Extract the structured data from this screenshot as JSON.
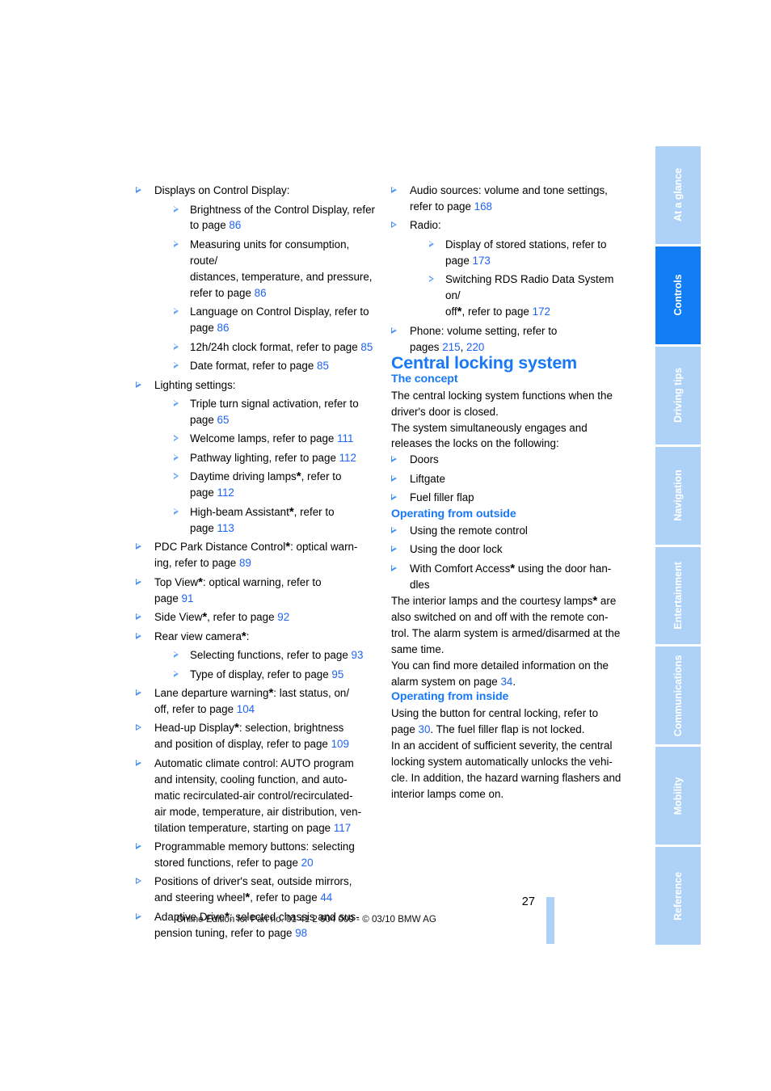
{
  "document": {
    "page_number": "27",
    "footer_text": "Online Edition for Part no. 01 41 2 604 009 - © 03/10 BMW AG"
  },
  "colors": {
    "heading_blue": "#1878f5",
    "link_blue": "#1f63f5",
    "tab_active": "#127ef5",
    "tab_inactive": "#aed2f7",
    "bullet_blue": "#4a90f0"
  },
  "chapter_tabs": [
    {
      "label": "At a glance",
      "active": false
    },
    {
      "label": "Controls",
      "active": true
    },
    {
      "label": "Driving tips",
      "active": false
    },
    {
      "label": "Navigation",
      "active": false
    },
    {
      "label": "Entertainment",
      "active": false
    },
    {
      "label": "Communications",
      "active": false
    },
    {
      "label": "Mobility",
      "active": false
    },
    {
      "label": "Reference",
      "active": false
    }
  ],
  "left_column": {
    "items": {
      "displays_heading": "Displays on Control Display:",
      "displays_sub": {
        "brightness_a": "Brightness of the Control Display, refer",
        "brightness_b": "to page ",
        "brightness_page": "86",
        "units_a": "Measuring units for consumption, route/",
        "units_b": "distances, temperature, and pressure,",
        "units_c": "refer to page ",
        "units_page": "86",
        "language_a": "Language on Control Display, refer to",
        "language_b": "page ",
        "language_page": "86",
        "clock_a": "12h/24h clock format, refer to page ",
        "clock_page": "85",
        "date_a": "Date format, refer to page ",
        "date_page": "85"
      },
      "lighting_heading": "Lighting settings:",
      "lighting_sub": {
        "turnsignal_a": "Triple turn signal activation, refer to",
        "turnsignal_b": "page ",
        "turnsignal_page": "65",
        "welcome_a": "Welcome lamps, refer to page ",
        "welcome_page": "111",
        "pathway_a": "Pathway lighting, refer to page ",
        "pathway_page": "112",
        "daytime_a": "Daytime driving lamps",
        "daytime_b": ", refer to",
        "daytime_c": "page ",
        "daytime_page": "112",
        "highbeam_a": "High-beam Assistant",
        "highbeam_b": ", refer to",
        "highbeam_c": "page ",
        "highbeam_page": "113"
      },
      "pdc_a": "PDC Park Distance Control",
      "pdc_b": ": optical warn-",
      "pdc_c": "ing, refer to page ",
      "pdc_page": "89",
      "topview_a": "Top View",
      "topview_b": ": optical warning, refer to",
      "topview_c": "page ",
      "topview_page": "91",
      "sideview_a": "Side View",
      "sideview_b": ", refer to page ",
      "sideview_page": "92",
      "rearcam_a": "Rear view camera",
      "rearcam_b": ":",
      "rearcam_sub": {
        "selecting_a": "Selecting functions, refer to page ",
        "selecting_page": "93",
        "typedisp_a": "Type of display, refer to page ",
        "typedisp_page": "95"
      },
      "lane_a": "Lane departure warning",
      "lane_b": ": last status, on/",
      "lane_c": "off, refer to page ",
      "lane_page": "104",
      "hud_a": "Head-up Display",
      "hud_b": ": selection, brightness",
      "hud_c": "and position of display, refer to page ",
      "hud_page": "109",
      "climate_a": "Automatic climate control: AUTO program",
      "climate_b": "and intensity, cooling function, and auto-",
      "climate_c": "matic recirculated-air control/recirculated-",
      "climate_d": "air mode, temperature, air distribution, ven-",
      "climate_e": "tilation temperature, starting on page ",
      "climate_page": "117",
      "memory_a": "Programmable memory buttons: selecting",
      "memory_b": "stored functions, refer to page ",
      "memory_page": "20",
      "positions_a": "Positions of driver's seat, outside mirrors,",
      "positions_b": "and steering wheel",
      "positions_c": ", refer to page ",
      "positions_page": "44",
      "adaptive_a": "Adaptive Drive",
      "adaptive_b": ": selected chassis and sus-",
      "adaptive_c": "pension tuning, refer to page ",
      "adaptive_page": "98"
    }
  },
  "right_column": {
    "items": {
      "audio_a": "Audio sources: volume and tone settings,",
      "audio_b": "refer to page ",
      "audio_page": "168",
      "radio_heading": "Radio:",
      "radio_sub": {
        "stored_a": "Display of stored stations, refer to",
        "stored_b": "page ",
        "stored_page": "173",
        "rds_a": "Switching RDS Radio Data System on/",
        "rds_b": "off",
        "rds_c": ", refer to page ",
        "rds_page": "172"
      },
      "phone_a": "Phone: volume setting, refer to",
      "phone_b": "pages ",
      "phone_page_1": "215",
      "phone_sep": ", ",
      "phone_page_2": "220"
    },
    "section": {
      "title": "Central locking system",
      "concept": {
        "heading": "The concept",
        "para1_a": "The central locking system functions when the",
        "para1_b": "driver's door is closed.",
        "para2_a": "The system simultaneously engages and",
        "para2_b": "releases the locks on the following:",
        "bullets": [
          "Doors",
          "Liftgate",
          "Fuel filler flap"
        ]
      },
      "outside": {
        "heading": "Operating from outside",
        "bullet1": "Using the remote control",
        "bullet2": "Using the door lock",
        "bullet3_a": "With Comfort Access",
        "bullet3_b": " using the door han-",
        "bullet3_c": "dles",
        "para1_a": "The interior lamps and the courtesy lamps",
        "para1_b": " are",
        "para1_c": "also switched on and off with the remote con-",
        "para1_d": "trol. The alarm system is armed/disarmed at the",
        "para1_e": "same time.",
        "para2_a": "You can find more detailed information on the",
        "para2_b": "alarm system on page ",
        "para2_page": "34",
        "para2_c": "."
      },
      "inside": {
        "heading": "Operating from inside",
        "para1_a": "Using the button for central locking, refer to",
        "para1_b": "page ",
        "para1_page": "30",
        "para1_c": ". The fuel filler flap is not locked.",
        "para2_a": "In an accident of sufficient severity, the central",
        "para2_b": "locking system automatically unlocks the vehi-",
        "para2_c": "cle. In addition, the hazard warning flashers and",
        "para2_d": "interior lamps come on."
      }
    }
  },
  "symbols": {
    "optional_marker": "*",
    "bullet_marker": "▷"
  }
}
